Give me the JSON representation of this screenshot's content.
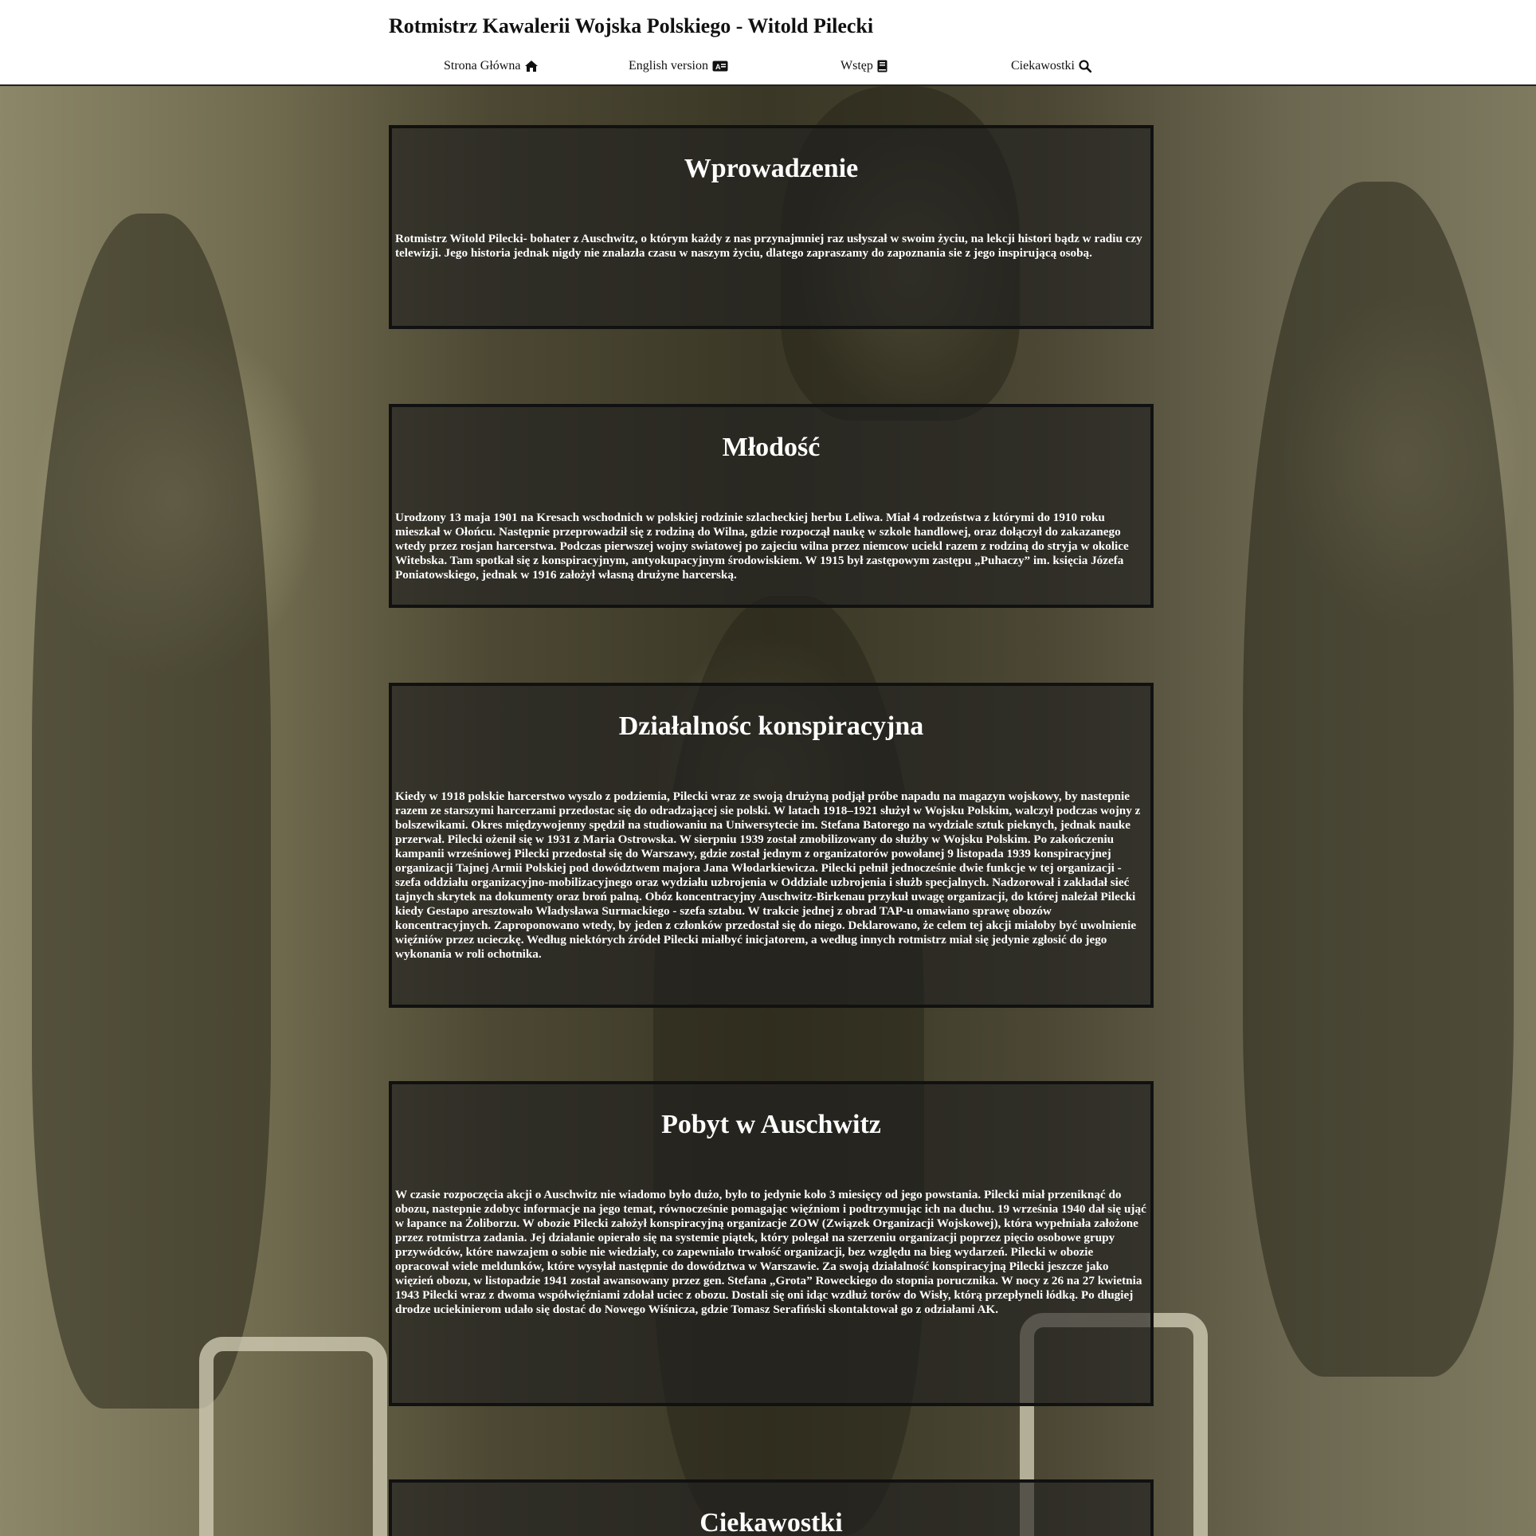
{
  "header": {
    "title": "Rotmistrz Kawalerii Wojska Polskiego - Witold Pilecki"
  },
  "nav": {
    "items": [
      {
        "label": "Strona Główna",
        "icon": "home-icon"
      },
      {
        "label": "English version",
        "icon": "language-icon"
      },
      {
        "label": "Wstęp",
        "icon": "book-icon"
      },
      {
        "label": "Ciekawostki",
        "icon": "search-icon"
      }
    ]
  },
  "sections": [
    {
      "title": "Wprowadzenie",
      "text": "Rotmistrz Witold Pilecki- bohater z Auschwitz, o którym każdy z nas przynajmniej raz usłyszał w swoim życiu, na lekcji histori bądz w radiu czy telewizji. Jego historia jednak nigdy nie znalazła czasu w naszym życiu, dlatego zapraszamy do zapoznania sie z jego inspirującą osobą."
    },
    {
      "title": "Młodość",
      "text": "Urodzony 13 maja 1901 na Kresach wschodnich w polskiej rodzinie szlacheckiej herbu Leliwa. Miał 4 rodzeństwa z którymi do 1910 roku mieszkał w Ołońcu. Następnie przeprowadził się z rodziną do Wilna, gdzie rozpoczął naukę w szkole handlowej, oraz dołączył do zakazanego wtedy przez rosjan harcerstwa. Podczas pierwszej wojny swiatowej po zajeciu wilna przez niemcow uciekl razem z rodziną do stryja w okolice Witebska. Tam spotkał się z konspiracyjnym, antyokupacyjnym środowiskiem. W 1915 był zastępowym zastępu „Puhaczy” im. księcia Józefa Poniatowskiego, jednak w 1916 założył własną drużyne harcerską."
    },
    {
      "title": "Działalnośc konspiracyjna",
      "text": "Kiedy w 1918 polskie harcerstwo wyszlo z podziemia, Pilecki wraz ze swoją drużyną podjął próbe napadu na magazyn wojskowy, by nastepnie razem ze starszymi harcerzami przedostac się do odradzającej sie polski. W latach 1918–1921 służył w Wojsku Polskim, walczył podczas wojny z bolszewikami. Okres międzywojenny spędził na studiowaniu na Uniwersytecie im. Stefana Batorego na wydziale sztuk pieknych, jednak nauke przerwał. Pilecki ożenił się w 1931 z Maria Ostrowska. W sierpniu 1939 został zmobilizowany do służby w Wojsku Polskim. Po zakończeniu kampanii wrześniowej Pilecki przedostał się do Warszawy, gdzie został jednym z organizatorów powołanej 9 listopada 1939 konspiracyjnej organizacji Tajnej Armii Polskiej pod dowództwem majora Jana Włodarkiewicza. Pilecki pełnił jednocześnie dwie funkcje w tej organizacji - szefa oddziału organizacyjno-mobilizacyjnego oraz wydziału uzbrojenia w Oddziale uzbrojenia i służb specjalnych. Nadzorował i zakładał sieć tajnych skrytek na dokumenty oraz broń palną. Obóz koncentracyjny Auschwitz-Birkenau przykuł uwagę organizacji, do której należał Pilecki kiedy Gestapo aresztowało Władysława Surmackiego - szefa sztabu. W trakcie jednej z obrad TAP-u omawiano sprawę obozów koncentracyjnych. Zaproponowano wtedy, by jeden z członków przedostał się do niego. Deklarowano, że celem tej akcji miałoby być uwolnienie więźniów przez ucieczkę. Według niektórych źródeł Pilecki miałbyć inicjatorem, a według innych rotmistrz miał się jedynie zgłosić do jego wykonania w roli ochotnika."
    },
    {
      "title": "Pobyt w Auschwitz",
      "text": "W czasie rozpoczęcia akcji o Auschwitz nie wiadomo było dużo, było to jedynie koło 3 miesięcy od jego powstania. Pilecki miał przeniknąć do obozu, nastepnie zdobyc informacje na jego temat, równocześnie pomagając więźniom i podtrzymując ich na duchu. 19 września 1940 dał się ująć w łapance na Żoliborzu. W obozie Pilecki założył konspiracyjną organizacje ZOW (Związek Organizacji Wojskowej), która wypełniała założone przez rotmistrza zadania. Jej działanie opierało się na systemie piątek, który polegał na szerzeniu organizacji poprzez pięcio osobowe grupy przywódców, które nawzajem o sobie nie wiedziały, co zapewniało trwałość organizacji, bez względu na bieg wydarzeń. Pilecki w obozie opracował wiele meldunków, które wysyłał następnie do dowództwa w Warszawie. Za swoją działalność konspiracyjną Pilecki jeszcze jako więzień obozu, w listopadzie 1941 został awansowany przez gen. Stefana „Grota” Roweckiego do stopnia porucznika. W nocy z 26 na 27 kwietnia 1943 Pilecki wraz z dwoma współwięźniami zdołał uciec z obozu. Dostali się oni idąc wzdłuż torów do Wisły, którą przepłyneli łódką. Po długiej drodze uciekinierom udało się dostać do Nowego Wiśnicza, gdzie Tomasz Serafiński skontaktował go z odziałami AK."
    },
    {
      "title": "Ciekawostki",
      "text": ""
    }
  ],
  "colors": {
    "section_background": "rgba(30,30,30,0.62)",
    "section_border": "#111111",
    "section_text": "#ffffff",
    "header_background": "#ffffff"
  }
}
